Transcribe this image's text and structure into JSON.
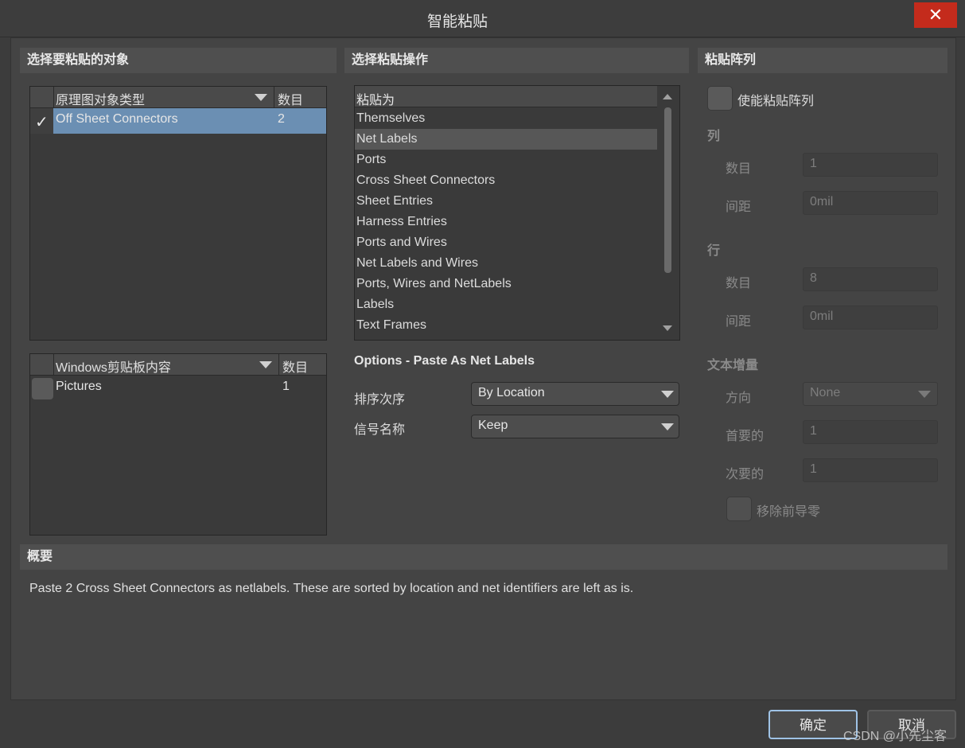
{
  "window": {
    "title": "智能粘贴",
    "close_glyph": "✕"
  },
  "left": {
    "header": "选择要粘贴的对象",
    "objects_table": {
      "col_type": "原理图对象类型",
      "col_count": "数目",
      "rows": [
        {
          "checked": true,
          "name": "Off Sheet Connectors",
          "count": "2"
        }
      ]
    },
    "clipboard_table": {
      "col_type": "Windows剪贴板内容",
      "col_count": "数目",
      "rows": [
        {
          "checked": false,
          "name": "Pictures",
          "count": "1"
        }
      ]
    }
  },
  "middle": {
    "header": "选择粘贴操作",
    "list_header": "粘贴为",
    "items": [
      "Themselves",
      "Net Labels",
      "Ports",
      "Cross Sheet Connectors",
      "Sheet Entries",
      "Harness Entries",
      "Ports and Wires",
      "Net Labels and Wires",
      "Ports, Wires and NetLabels",
      "Labels",
      "Text Frames"
    ],
    "selected_item": "Net Labels",
    "options_title": "Options - Paste As Net Labels",
    "sort_label": "排序次序",
    "sort_value": "By Location",
    "signal_label": "信号名称",
    "signal_value": "Keep"
  },
  "right": {
    "header": "粘贴阵列",
    "enable_label": "使能粘贴阵列",
    "column_title": "列",
    "col_count_label": "数目",
    "col_count_value": "1",
    "col_spacing_label": "间距",
    "col_spacing_value": "0mil",
    "row_title": "行",
    "row_count_label": "数目",
    "row_count_value": "8",
    "row_spacing_label": "间距",
    "row_spacing_value": "0mil",
    "text_inc_title": "文本增量",
    "direction_label": "方向",
    "direction_value": "None",
    "primary_label": "首要的",
    "primary_value": "1",
    "secondary_label": "次要的",
    "secondary_value": "1",
    "remove_zeros_label": "移除前导零"
  },
  "summary": {
    "header": "概要",
    "text": "Paste 2 Cross Sheet Connectors as netlabels. These are sorted by location and net identifiers are left as is."
  },
  "buttons": {
    "ok": "确定",
    "cancel": "取消"
  },
  "watermark": "CSDN @小先尘客"
}
